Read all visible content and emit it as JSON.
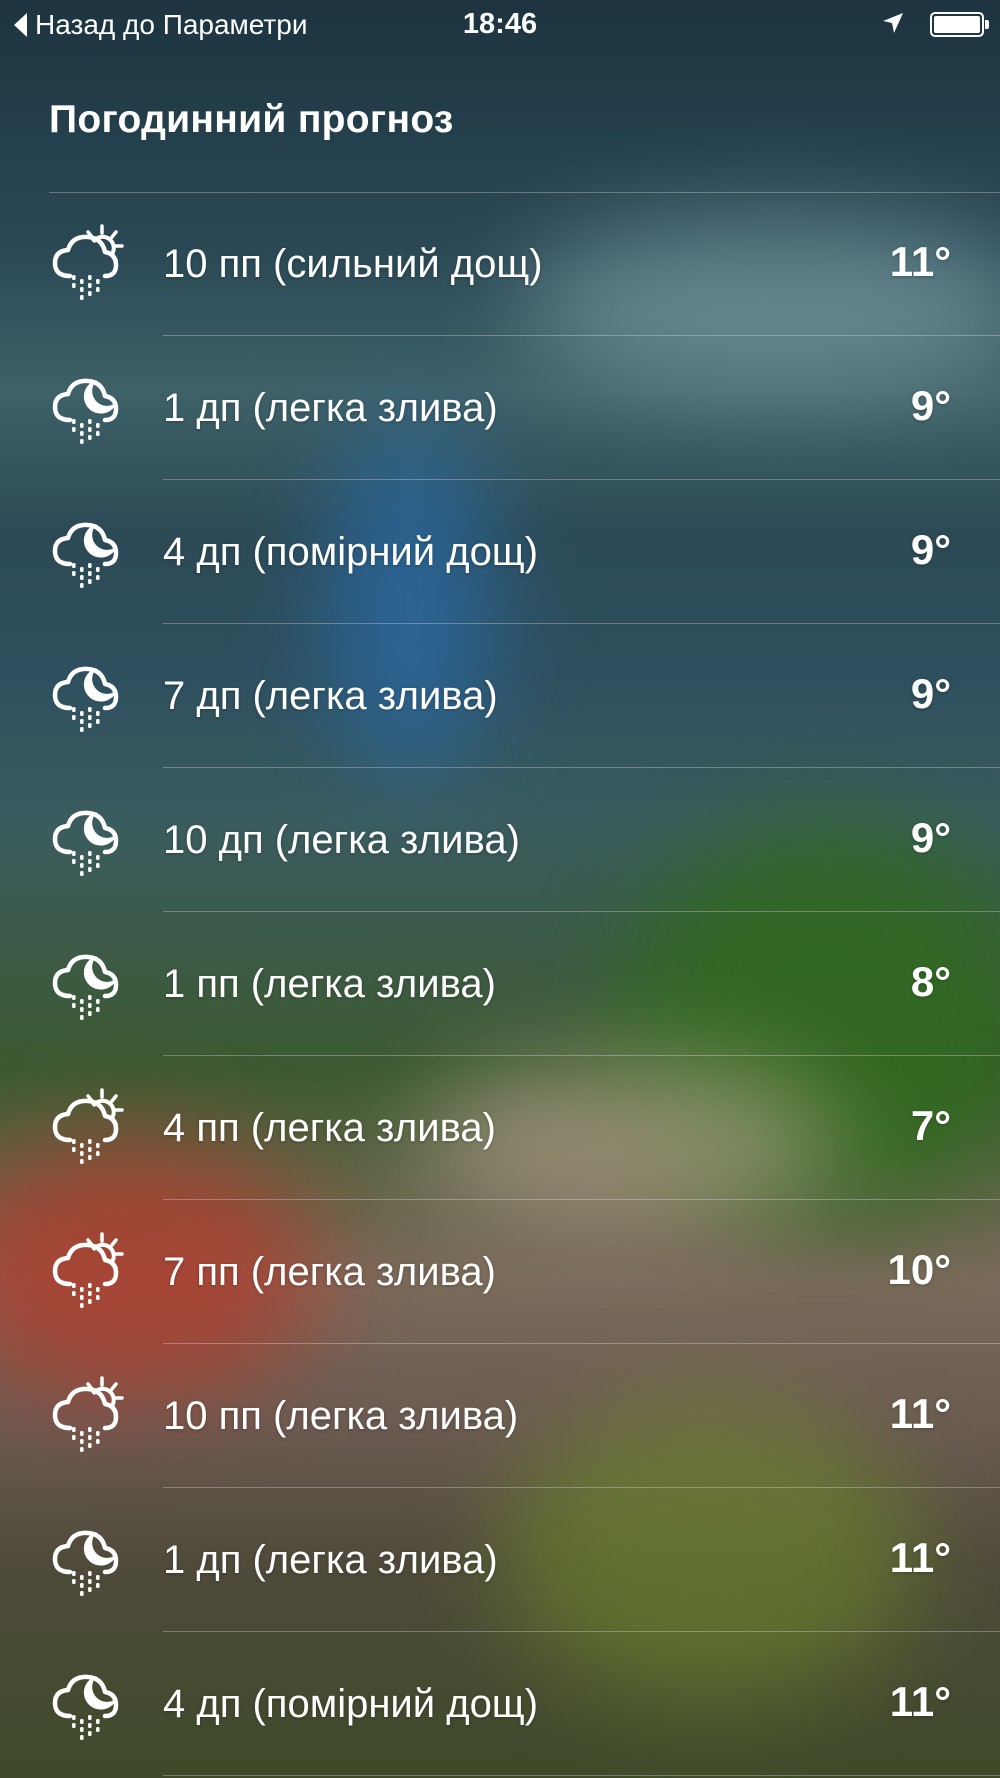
{
  "status_bar": {
    "back_label": "Назад до Параметри",
    "time": "18:46",
    "location_icon": "location-arrow-icon",
    "battery_icon": "battery-icon"
  },
  "page": {
    "title": "Погодинний прогноз"
  },
  "forecast": [
    {
      "label": "10 пп (сильний дощ)",
      "temp": "11°",
      "icon": "sun-cloud-rain-icon"
    },
    {
      "label": "1 дп (легка злива)",
      "temp": "9°",
      "icon": "moon-cloud-rain-icon"
    },
    {
      "label": "4 дп (помірний дощ)",
      "temp": "9°",
      "icon": "moon-cloud-rain-icon"
    },
    {
      "label": "7 дп (легка злива)",
      "temp": "9°",
      "icon": "moon-cloud-rain-icon"
    },
    {
      "label": "10 дп (легка злива)",
      "temp": "9°",
      "icon": "moon-cloud-rain-icon"
    },
    {
      "label": "1 пп (легка злива)",
      "temp": "8°",
      "icon": "moon-cloud-rain-icon"
    },
    {
      "label": "4 пп (легка злива)",
      "temp": "7°",
      "icon": "sun-cloud-rain-icon"
    },
    {
      "label": "7 пп (легка злива)",
      "temp": "10°",
      "icon": "sun-cloud-rain-icon"
    },
    {
      "label": "10 пп (легка злива)",
      "temp": "11°",
      "icon": "sun-cloud-rain-icon"
    },
    {
      "label": "1 дп (легка злива)",
      "temp": "11°",
      "icon": "moon-cloud-rain-icon"
    },
    {
      "label": "4 дп (помірний дощ)",
      "temp": "11°",
      "icon": "moon-cloud-rain-icon"
    }
  ]
}
